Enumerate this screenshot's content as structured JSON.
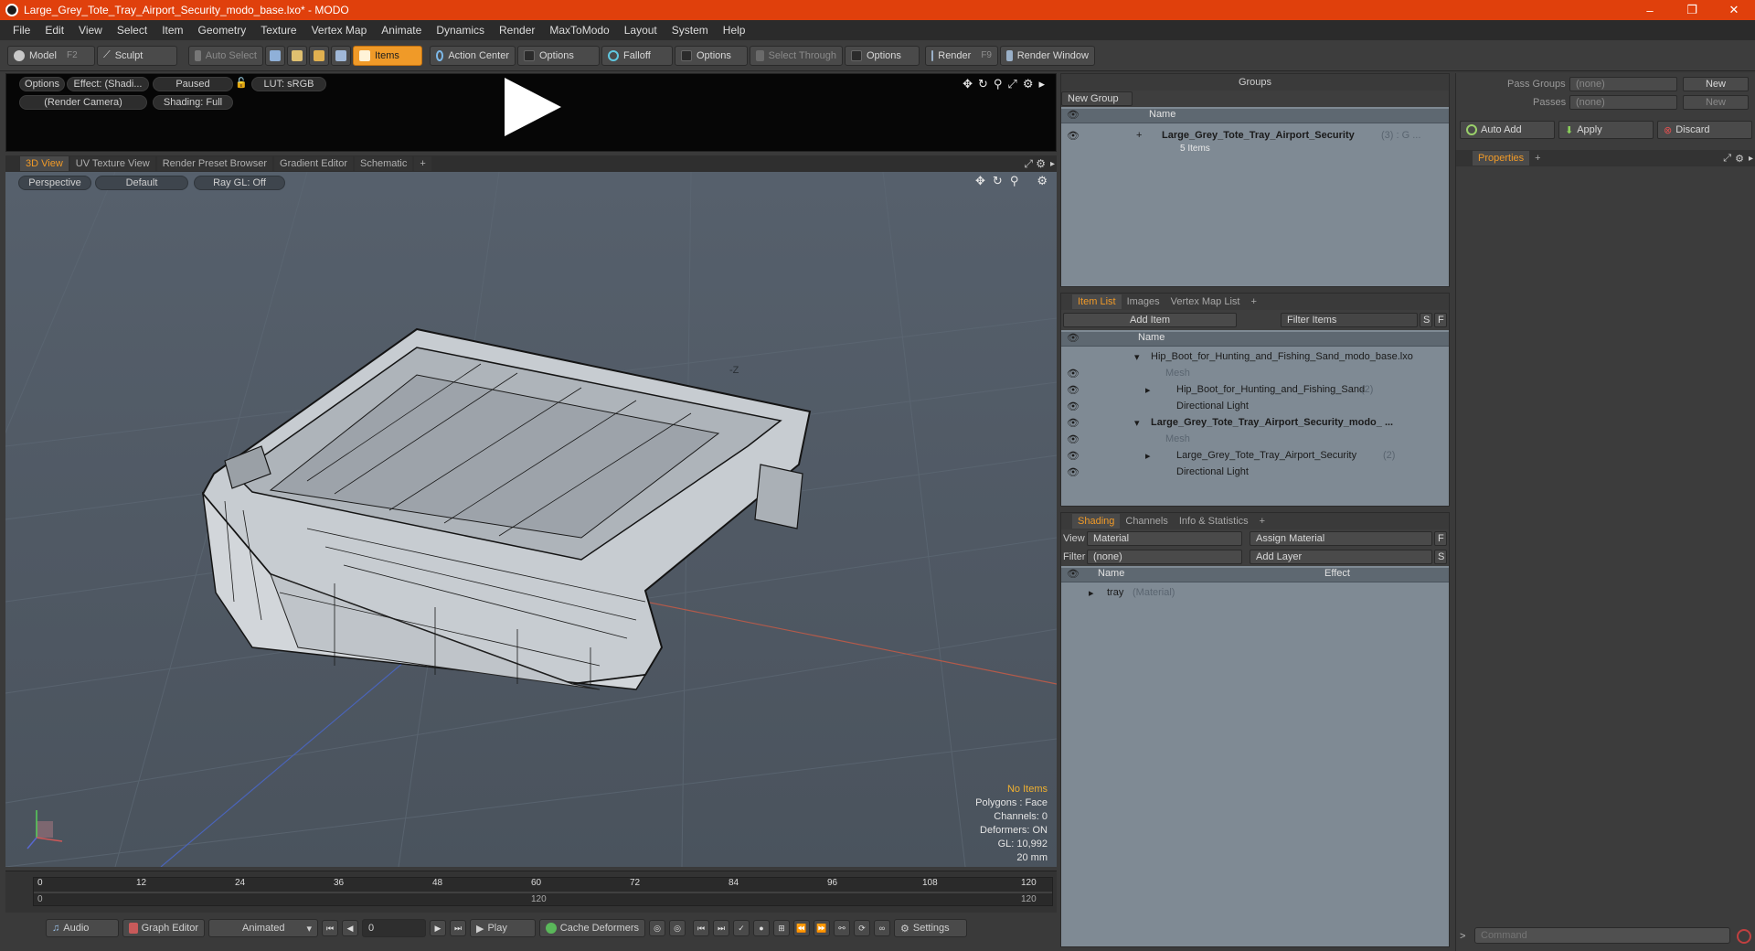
{
  "window": {
    "title": "Large_Grey_Tote_Tray_Airport_Security_modo_base.lxo* - MODO",
    "minimize": "–",
    "maximize": "❐",
    "close": "✕"
  },
  "menu": [
    "File",
    "Edit",
    "View",
    "Select",
    "Item",
    "Geometry",
    "Texture",
    "Vertex Map",
    "Animate",
    "Dynamics",
    "Render",
    "MaxToModo",
    "Layout",
    "System",
    "Help"
  ],
  "toolbar": {
    "model": "Model",
    "model_key": "F2",
    "sculpt": "Sculpt",
    "auto_select": "Auto Select",
    "items": "Items",
    "action_center": "Action Center",
    "options1": "Options",
    "falloff": "Falloff",
    "options2": "Options",
    "select_through": "Select Through",
    "options3": "Options",
    "render": "Render",
    "render_key": "F9",
    "render_window": "Render Window"
  },
  "preview": {
    "options": "Options",
    "effect": "Effect: (Shadi...",
    "paused": "Paused",
    "lut": "LUT: sRGB",
    "camera": "(Render Camera)",
    "shading": "Shading: Full"
  },
  "viewport_tabs": [
    "3D View",
    "UV Texture View",
    "Render Preset Browser",
    "Gradient Editor",
    "Schematic",
    "+"
  ],
  "viewport": {
    "perspective": "Perspective",
    "default": "Default",
    "raygl": "Ray GL: Off",
    "axis_label": "-Z",
    "stats": {
      "no_items": "No Items",
      "polygons": "Polygons : Face",
      "channels": "Channels: 0",
      "deformers": "Deformers: ON",
      "gl": "GL: 10,992",
      "size": "20 mm"
    }
  },
  "timeline": {
    "ticks": [
      "0",
      "12",
      "24",
      "36",
      "48",
      "60",
      "72",
      "84",
      "96",
      "108",
      "120"
    ],
    "sub_start": "0",
    "sub_mid": "120",
    "sub_end": "120"
  },
  "transport": {
    "audio": "Audio",
    "graph_editor": "Graph Editor",
    "animated": "Animated",
    "frame": "0",
    "play": "Play",
    "cache": "Cache Deformers",
    "settings": "Settings"
  },
  "groups": {
    "title": "Groups",
    "new_group": "New Group",
    "col_name": "Name",
    "item_name": "Large_Grey_Tote_Tray_Airport_Security",
    "item_count": "(3) : G ...",
    "item_sub": "5 Items"
  },
  "pass_groups": {
    "pass_groups_label": "Pass Groups",
    "pass_groups_value": "(none)",
    "new1": "New",
    "passes_label": "Passes",
    "passes_value": "(none)",
    "new2": "New",
    "auto_add": "Auto Add",
    "apply": "Apply",
    "discard": "Discard"
  },
  "properties": {
    "tab": "Properties",
    "plus": "+",
    "command_placeholder": "Command"
  },
  "item_list": {
    "tabs": [
      "Item List",
      "Images",
      "Vertex Map List",
      "+"
    ],
    "add_item": "Add Item",
    "filter": "Filter Items",
    "s": "S",
    "f": "F",
    "col_name": "Name",
    "rows": [
      {
        "label": "Hip_Boot_for_Hunting_and_Fishing_Sand_modo_base.lxo",
        "count": ""
      },
      {
        "label": "Mesh",
        "count": ""
      },
      {
        "label": "Hip_Boot_for_Hunting_and_Fishing_Sand",
        "count": "(2)"
      },
      {
        "label": "Directional Light",
        "count": ""
      },
      {
        "label": "Large_Grey_Tote_Tray_Airport_Security_modo_ ...",
        "count": ""
      },
      {
        "label": "Mesh",
        "count": ""
      },
      {
        "label": "Large_Grey_Tote_Tray_Airport_Security",
        "count": "(2)"
      },
      {
        "label": "Directional Light",
        "count": ""
      }
    ]
  },
  "shading": {
    "tabs": [
      "Shading",
      "Channels",
      "Info & Statistics",
      "+"
    ],
    "view_label": "View",
    "view_value": "Material",
    "assign": "Assign Material",
    "f": "F",
    "filter_label": "Filter",
    "filter_value": "(none)",
    "add_layer": "Add Layer",
    "s": "S",
    "col_name": "Name",
    "col_effect": "Effect",
    "row_name": "tray",
    "row_type": "(Material)"
  },
  "colors": {
    "accent": "#f09a28",
    "titlebar": "#e0400c"
  }
}
